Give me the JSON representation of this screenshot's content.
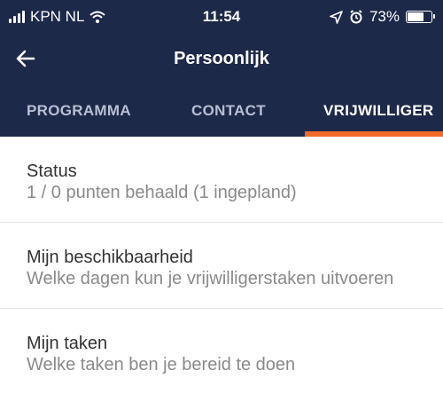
{
  "status_bar": {
    "carrier": "KPN NL",
    "time": "11:54",
    "battery_pct": "73%",
    "battery_level": 0.73
  },
  "nav": {
    "title": "Persoonlijk",
    "back_icon": "arrow-left-icon"
  },
  "tabs": [
    {
      "label": "PROGRAMMA",
      "active": false
    },
    {
      "label": "CONTACT",
      "active": false
    },
    {
      "label": "VRIJWILLIGER",
      "active": true
    }
  ],
  "items": [
    {
      "title": "Status",
      "subtitle": "1 / 0 punten behaald (1 ingepland)"
    },
    {
      "title": "Mijn beschikbaarheid",
      "subtitle": "Welke dagen kun je vrijwilligerstaken uitvoeren"
    },
    {
      "title": "Mijn taken",
      "subtitle": "Welke taken ben je bereid te doen"
    }
  ],
  "colors": {
    "header_bg": "#1d2949",
    "accent": "#f06a25"
  }
}
